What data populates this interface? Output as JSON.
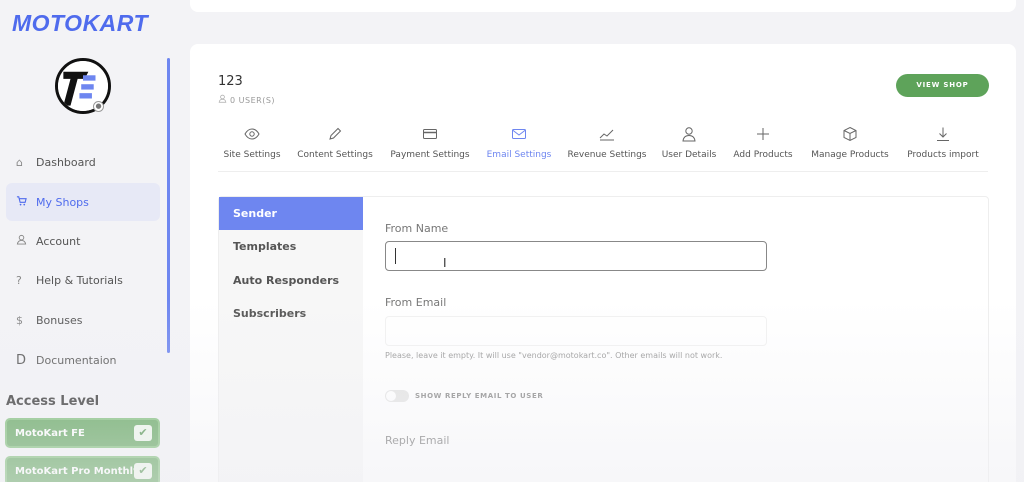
{
  "brand": {
    "logo_text": "MOTOKART",
    "accent": "#4f6bed",
    "green": "#5ea35a"
  },
  "sidebar": {
    "items": [
      {
        "label": "Dashboard",
        "icon": "home-icon"
      },
      {
        "label": "My Shops",
        "icon": "cart-icon",
        "active": true
      },
      {
        "label": "Account",
        "icon": "user-icon"
      },
      {
        "label": "Help & Tutorials",
        "icon": "question-icon"
      },
      {
        "label": "Bonuses",
        "icon": "dollar-icon"
      },
      {
        "label": "Documentaion",
        "icon": "doc-icon"
      }
    ],
    "icon_glyphs": [
      "⌂",
      "🛒",
      "👤",
      "?",
      "$",
      "D"
    ],
    "access_title": "Access Level",
    "access_levels": [
      "MotoKart FE",
      "MotoKart Pro Monthly"
    ]
  },
  "shop": {
    "name": "123",
    "users": "0 USER(S)",
    "view_shop": "VIEW SHOP"
  },
  "tabs": [
    {
      "label": "Site Settings",
      "icon": "eye-icon"
    },
    {
      "label": "Content Settings",
      "icon": "pencil-icon"
    },
    {
      "label": "Payment Settings",
      "icon": "credit-card-icon"
    },
    {
      "label": "Email Settings",
      "icon": "envelope-icon",
      "active": true
    },
    {
      "label": "Revenue Settings",
      "icon": "chart-line-icon"
    },
    {
      "label": "User Details",
      "icon": "user-icon"
    },
    {
      "label": "Add Products",
      "icon": "plus-icon"
    },
    {
      "label": "Manage Products",
      "icon": "box-icon"
    },
    {
      "label": "Products import",
      "icon": "download-icon"
    }
  ],
  "email": {
    "subnav": [
      "Sender",
      "Templates",
      "Auto Responders",
      "Subscribers"
    ],
    "from_name_label": "From Name",
    "from_name_value": "",
    "from_email_label": "From Email",
    "from_email_value": "",
    "help_text": "Please, leave it empty. It will use \"vendor@motokart.co\". Other emails will not work.",
    "toggle_label": "SHOW REPLY EMAIL TO USER",
    "reply_email_label": "Reply Email"
  }
}
